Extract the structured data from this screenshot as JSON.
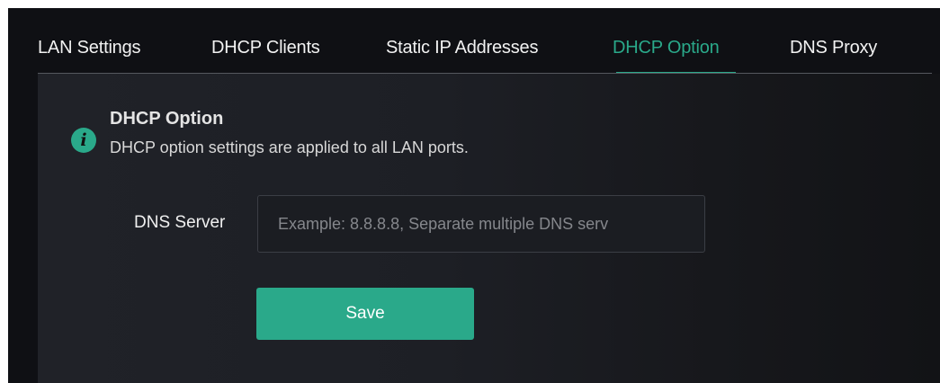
{
  "tabs": [
    {
      "label": "LAN Settings",
      "active": false
    },
    {
      "label": "DHCP Clients",
      "active": false
    },
    {
      "label": "Static IP Addresses",
      "active": false
    },
    {
      "label": "DHCP Option",
      "active": true
    },
    {
      "label": "DNS Proxy",
      "active": false
    }
  ],
  "info": {
    "icon": "info-icon",
    "icon_glyph": "i",
    "title": "DHCP Option",
    "description": "DHCP option settings are applied to all LAN ports."
  },
  "form": {
    "dns_server_label": "DNS Server",
    "dns_server_value": "",
    "dns_server_placeholder": "Example: 8.8.8.8, Separate multiple DNS serv",
    "save_label": "Save"
  },
  "colors": {
    "accent": "#2aa98a",
    "background": "#0f1014",
    "panel": "#202228"
  }
}
